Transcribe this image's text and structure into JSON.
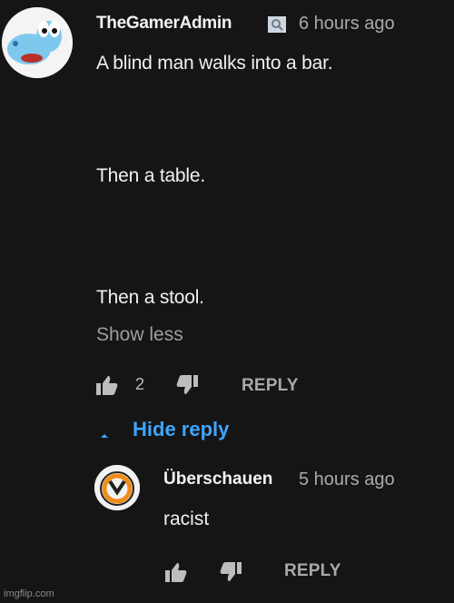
{
  "comment": {
    "username": "TheGamerAdmin",
    "time": "6 hours ago",
    "lines": [
      "A blind man walks into a bar.",
      "Then a table.",
      "Then a stool."
    ],
    "show_less": "Show less",
    "like_count": "2",
    "reply_label": "REPLY",
    "hide_reply": "Hide reply",
    "avatar_icon": "yoshi-avatar-icon",
    "badge_icon": "verified-badge-icon"
  },
  "reply": {
    "username": "Überschauen",
    "time": "5 hours ago",
    "text": "racist",
    "reply_label": "REPLY",
    "avatar_icon": "overwatch-logo-icon"
  },
  "watermark": "imgflip.com",
  "colors": {
    "background": "#151515",
    "link": "#3ea6ff",
    "muted": "#aaaaaa"
  }
}
